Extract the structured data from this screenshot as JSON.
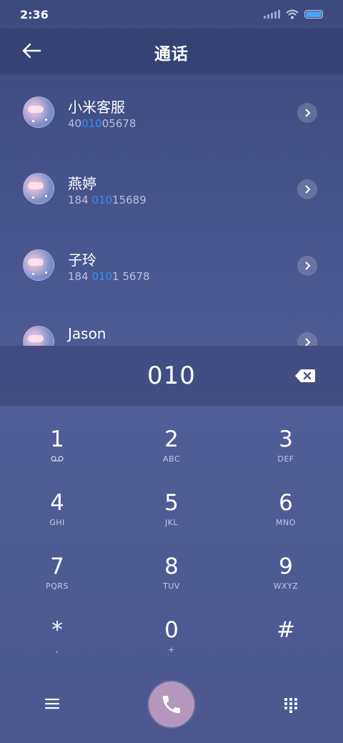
{
  "status_bar": {
    "time": "2:36"
  },
  "header": {
    "title": "通话"
  },
  "contacts": [
    {
      "name": "小米客服",
      "number_parts": [
        "40",
        "010",
        "05678"
      ]
    },
    {
      "name": "燕婷",
      "number_parts": [
        "184 ",
        "010",
        "15689"
      ]
    },
    {
      "name": "子玲",
      "number_parts": [
        "184 ",
        "010",
        "1 5678"
      ]
    },
    {
      "name": "Jason",
      "number_parts": [
        "",
        "",
        ""
      ]
    }
  ],
  "dialer": {
    "number": "010",
    "keys": [
      {
        "digit": "1",
        "letters": ""
      },
      {
        "digit": "2",
        "letters": "ABC"
      },
      {
        "digit": "3",
        "letters": "DEF"
      },
      {
        "digit": "4",
        "letters": "GHI"
      },
      {
        "digit": "5",
        "letters": "JKL"
      },
      {
        "digit": "6",
        "letters": "MNO"
      },
      {
        "digit": "7",
        "letters": "PQRS"
      },
      {
        "digit": "8",
        "letters": "TUV"
      },
      {
        "digit": "9",
        "letters": "WXYZ"
      },
      {
        "digit": "*",
        "letters": ","
      },
      {
        "digit": "0",
        "letters": "+"
      },
      {
        "digit": "#",
        "letters": ""
      }
    ]
  },
  "colors": {
    "highlight": "#2a95f5",
    "call_button": "#b597bd"
  },
  "icons": {
    "back": "arrow-left-icon",
    "chevron": "chevron-right-icon",
    "backspace": "backspace-icon",
    "voicemail": "voicemail-icon",
    "menu": "menu-icon",
    "call": "phone-icon",
    "dialpad": "dialpad-icon"
  }
}
